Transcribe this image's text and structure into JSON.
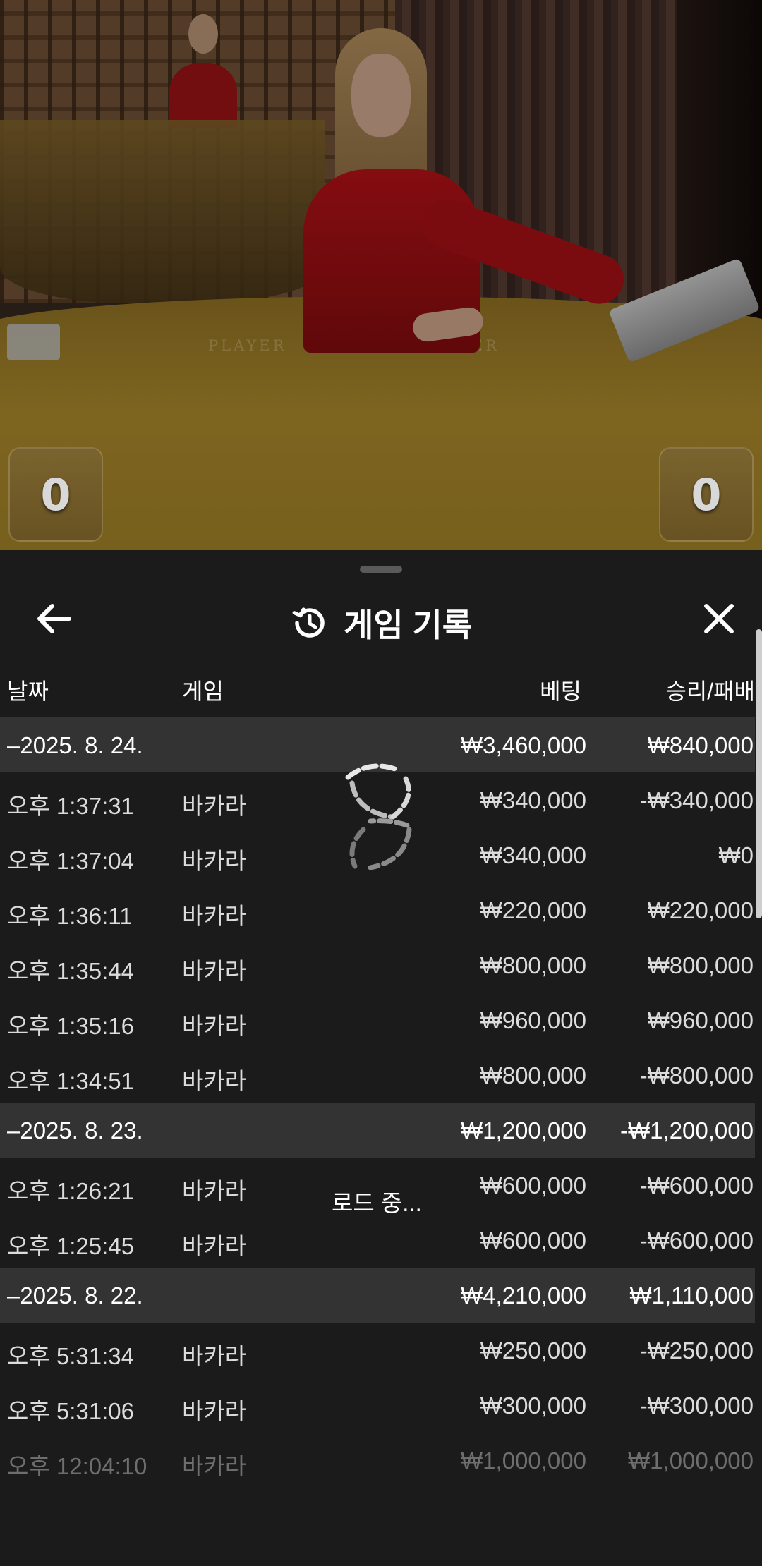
{
  "video": {
    "felt_labels": {
      "player": "PLAYER",
      "banker": "BANKER"
    },
    "player_score": "0",
    "banker_score": "0"
  },
  "sheet": {
    "title": "게임 기록",
    "icons": {
      "back": "arrow-left-icon",
      "history": "history-icon",
      "close": "close-icon",
      "loader": "spinner-icon"
    },
    "columns": {
      "date": "날짜",
      "game": "게임",
      "bet": "베팅",
      "result": "승리/패배"
    },
    "loading_label": "로드 중...",
    "rows": [
      {
        "type": "day",
        "date": "–2025. 8. 24.",
        "game": "",
        "bet": "₩3,460,000",
        "result": "₩840,000"
      },
      {
        "type": "item",
        "date": "오후 1:37:31",
        "game": "바카라",
        "bet": "₩340,000",
        "result": "-₩340,000"
      },
      {
        "type": "item",
        "date": "오후 1:37:04",
        "game": "바카라",
        "bet": "₩340,000",
        "result": "₩0"
      },
      {
        "type": "item",
        "date": "오후 1:36:11",
        "game": "바카라",
        "bet": "₩220,000",
        "result": "₩220,000"
      },
      {
        "type": "item",
        "date": "오후 1:35:44",
        "game": "바카라",
        "bet": "₩800,000",
        "result": "₩800,000"
      },
      {
        "type": "item",
        "date": "오후 1:35:16",
        "game": "바카라",
        "bet": "₩960,000",
        "result": "₩960,000"
      },
      {
        "type": "item",
        "date": "오후 1:34:51",
        "game": "바카라",
        "bet": "₩800,000",
        "result": "-₩800,000"
      },
      {
        "type": "day",
        "date": "–2025. 8. 23.",
        "game": "",
        "bet": "₩1,200,000",
        "result": "-₩1,200,000"
      },
      {
        "type": "item",
        "date": "오후 1:26:21",
        "game": "바카라",
        "bet": "₩600,000",
        "result": "-₩600,000"
      },
      {
        "type": "item",
        "date": "오후 1:25:45",
        "game": "바카라",
        "bet": "₩600,000",
        "result": "-₩600,000"
      },
      {
        "type": "day",
        "date": "–2025. 8. 22.",
        "game": "",
        "bet": "₩4,210,000",
        "result": "₩1,110,000"
      },
      {
        "type": "item",
        "date": "오후 5:31:34",
        "game": "바카라",
        "bet": "₩250,000",
        "result": "-₩250,000"
      },
      {
        "type": "item",
        "date": "오후 5:31:06",
        "game": "바카라",
        "bet": "₩300,000",
        "result": "-₩300,000"
      },
      {
        "type": "item",
        "date": "오후 12:04:10",
        "game": "바카라",
        "bet": "₩1,000,000",
        "result": "₩1,000,000",
        "faded": true
      }
    ]
  }
}
